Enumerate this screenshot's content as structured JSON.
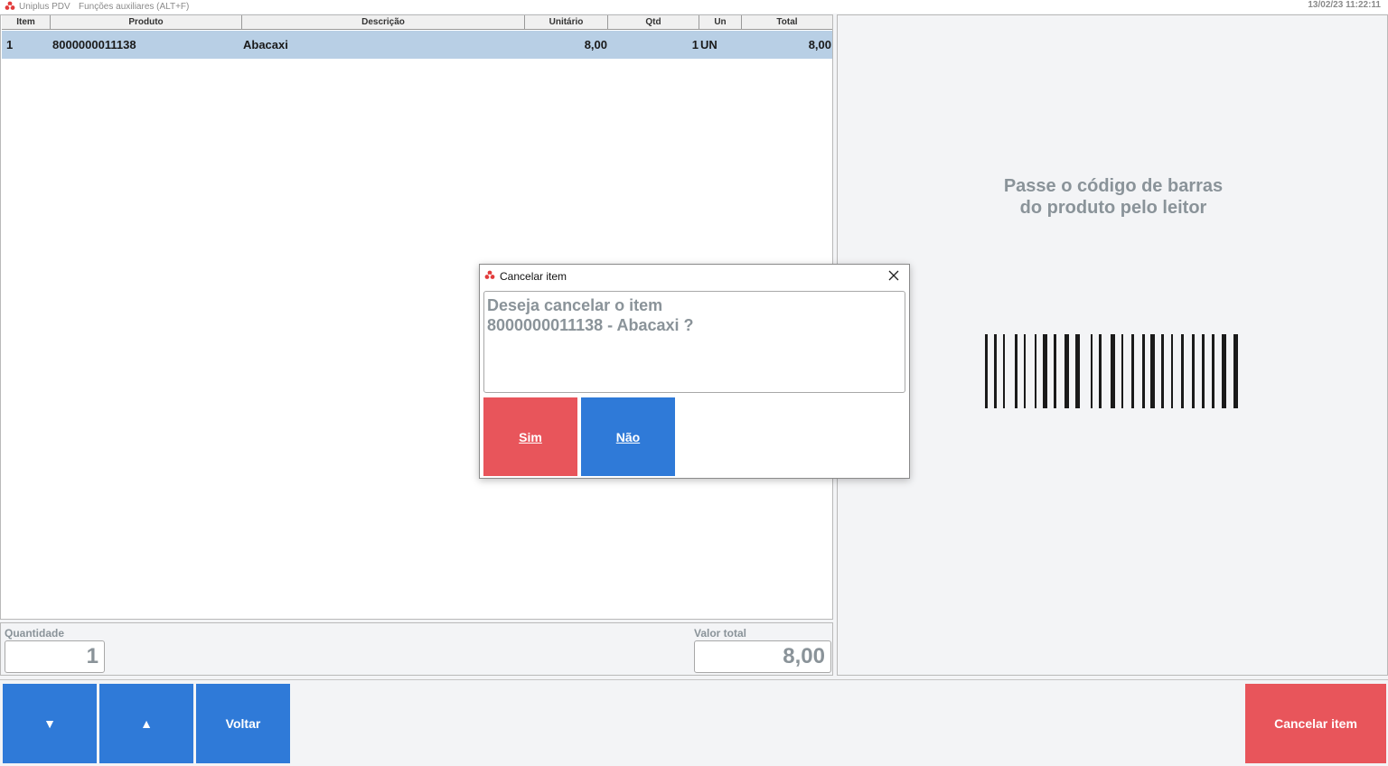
{
  "topbar": {
    "app_name": "Uniplus PDV",
    "menu_label": "Funções auxiliares (ALT+F)",
    "datetime": "13/02/23 11:22:11"
  },
  "table": {
    "columns": [
      "Item",
      "Produto",
      "Descrição",
      "Unitário",
      "Qtd",
      "Un",
      "Total"
    ],
    "rows": [
      {
        "item": "1",
        "produto": "8000000011138",
        "descricao": "Abacaxi",
        "unitario": "8,00",
        "qtd": "1",
        "un": "UN",
        "total": "8,00"
      }
    ]
  },
  "info": {
    "quantidade_label": "Quantidade",
    "quantidade_value": "1",
    "valor_total_label": "Valor total",
    "valor_total_value": "8,00"
  },
  "scanner": {
    "line1": "Passe o código de barras",
    "line2": "do produto pelo leitor"
  },
  "footer": {
    "down_label": "▼",
    "up_label": "▲",
    "back_label": "Voltar",
    "cancel_item_label": "Cancelar item"
  },
  "dialog": {
    "title": "Cancelar item",
    "message_line1": "Deseja cancelar o item",
    "message_line2": "8000000011138 - Abacaxi ?",
    "yes_label": "Sim",
    "no_label": "Não"
  },
  "colors": {
    "blue_button": "#2f7ad8",
    "red_button": "#e8555b",
    "row_selected": "#b8cfe5"
  }
}
